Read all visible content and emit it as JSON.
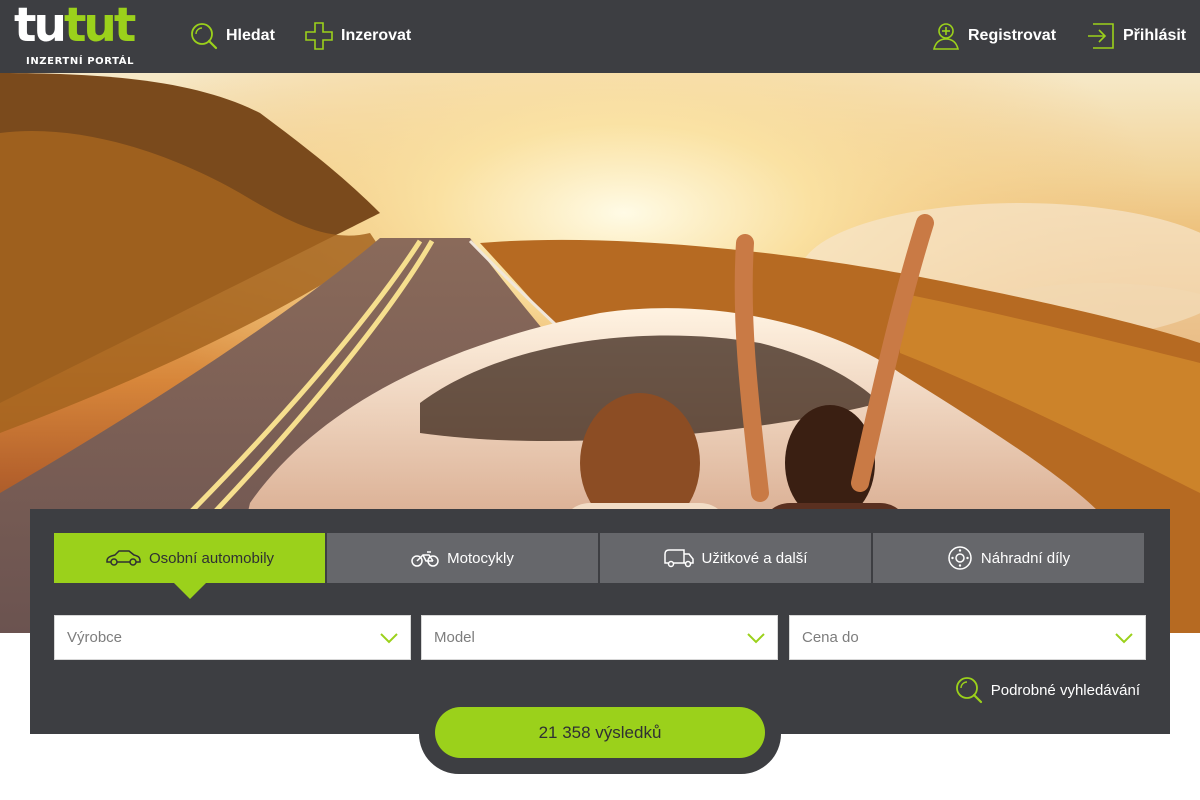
{
  "brand": {
    "word_white": "tu",
    "word_green": "tut",
    "tagline": "INZERTNÍ PORTÁL"
  },
  "nav": {
    "search": "Hledat",
    "advertise": "Inzerovat",
    "register": "Registrovat",
    "login": "Přihlásit"
  },
  "hero": {
    "image": "convertible-road-sunset-photo"
  },
  "tabs": [
    {
      "label": "Osobní automobily",
      "icon": "car-icon",
      "active": true
    },
    {
      "label": "Motocykly",
      "icon": "motorcycle-icon",
      "active": false
    },
    {
      "label": "Užitkové a další",
      "icon": "van-icon",
      "active": false
    },
    {
      "label": "Náhradní díly",
      "icon": "brake-disc-icon",
      "active": false
    }
  ],
  "filters": {
    "manufacturer_placeholder": "Výrobce",
    "model_placeholder": "Model",
    "price_placeholder": "Cena do"
  },
  "advanced_search": "Podrobné vyhledávání",
  "results_button": "21 358 výsledků",
  "colors": {
    "accent": "#9bd11b",
    "dark": "#3d3e42",
    "tab_inactive": "#66676b"
  }
}
